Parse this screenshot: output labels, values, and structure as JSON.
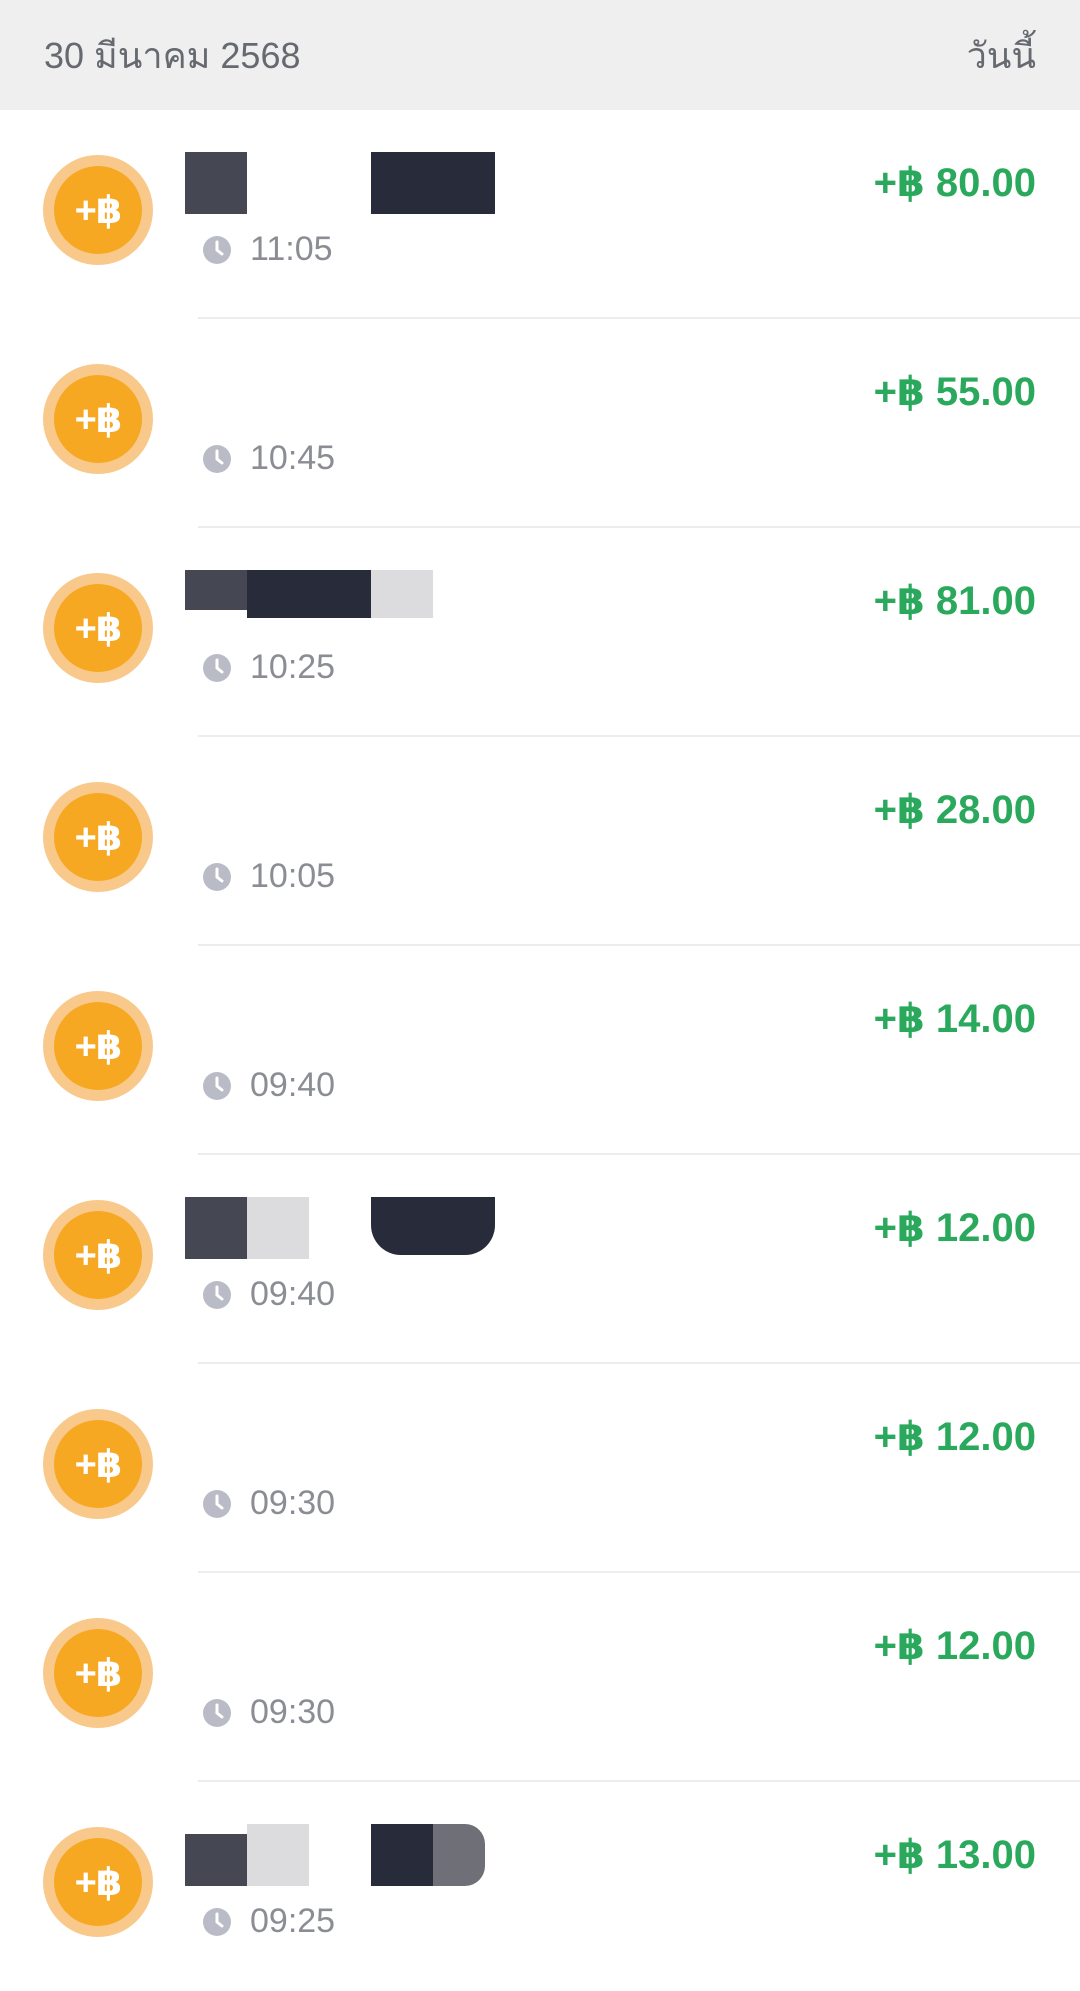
{
  "header": {
    "date": "30 มีนาคม 2568",
    "today_label": "วันนี้"
  },
  "icons": {
    "coin": "baht-coin-icon",
    "clock": "clock-icon"
  },
  "colors": {
    "amount_green": "#2aa95d",
    "coin_orange": "#f7a823",
    "header_bg": "#efefef"
  },
  "coin_label": "+฿",
  "transactions": [
    {
      "time": "11:05",
      "amount": "+฿ 80.00"
    },
    {
      "time": "10:45",
      "amount": "+฿ 55.00"
    },
    {
      "time": "10:25",
      "amount": "+฿ 81.00"
    },
    {
      "time": "10:05",
      "amount": "+฿ 28.00"
    },
    {
      "time": "09:40",
      "amount": "+฿ 14.00"
    },
    {
      "time": "09:40",
      "amount": "+฿ 12.00"
    },
    {
      "time": "09:30",
      "amount": "+฿ 12.00"
    },
    {
      "time": "09:30",
      "amount": "+฿ 12.00"
    },
    {
      "time": "09:25",
      "amount": "+฿ 13.00"
    }
  ]
}
